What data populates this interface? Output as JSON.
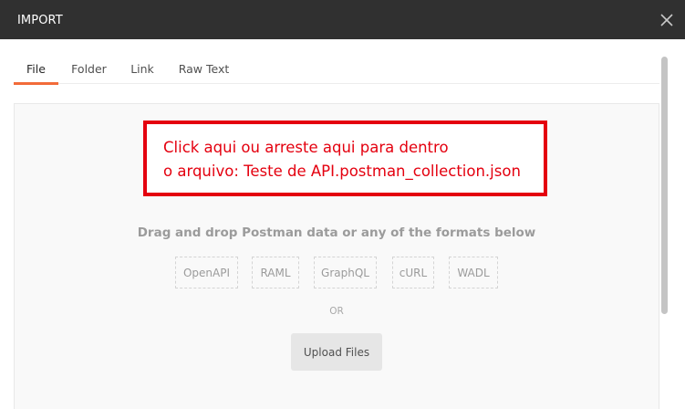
{
  "dialog": {
    "title": "IMPORT",
    "close_icon": "close-icon"
  },
  "tabs": [
    {
      "label": "File",
      "active": true
    },
    {
      "label": "Folder",
      "active": false
    },
    {
      "label": "Link",
      "active": false
    },
    {
      "label": "Raw Text",
      "active": false
    }
  ],
  "annotation": {
    "line1": "Click aqui ou arreste aqui para dentro",
    "line2": "o arquivo: Teste de API.postman_collection.json",
    "color": "#e4000f"
  },
  "dropzone": {
    "hint": "Drag and drop Postman data or any of the formats below",
    "formats": [
      "OpenAPI",
      "RAML",
      "GraphQL",
      "cURL",
      "WADL"
    ],
    "or_label": "OR",
    "upload_label": "Upload Files"
  },
  "colors": {
    "titlebar": "#303030",
    "tab_accent": "#f26b3a"
  }
}
